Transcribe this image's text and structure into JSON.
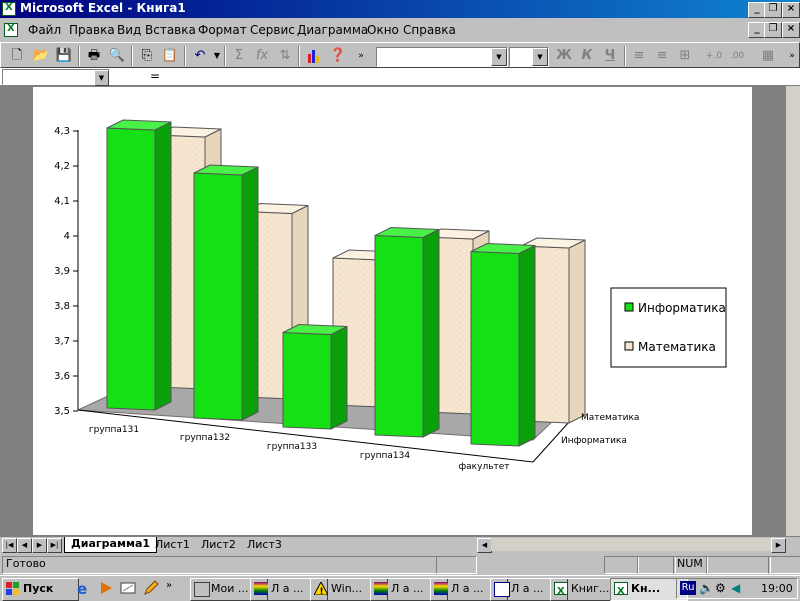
{
  "window": {
    "title": "Microsoft Excel - Книга1"
  },
  "menu": [
    "Файл",
    "Правка",
    "Вид",
    "Вставка",
    "Формат",
    "Сервис",
    "Диаграмма",
    "Окно",
    "Справка"
  ],
  "toolbar": {
    "undo_icon": "undo-icon",
    "sum_symbol": "Σ",
    "fx_symbol": "fx",
    "bold": "Ж",
    "italic": "К",
    "underline": "Ч"
  },
  "formula": {
    "eq_sign": "="
  },
  "sheet_tabs": [
    "Диаграмма1",
    "Лист1",
    "Лист2",
    "Лист3"
  ],
  "status": {
    "ready": "Готово",
    "num": "NUM"
  },
  "taskbar": {
    "start": "Пуск",
    "buttons": [
      "Мои ...",
      "Л а ...",
      "Win...",
      "Л а ...",
      "Л а ...",
      "Л а ...",
      "Книг...",
      "Кн..."
    ],
    "lang": "Ru",
    "clock": "19:00"
  },
  "chart_data": {
    "type": "bar",
    "subtype": "3d-column",
    "categories": [
      "группа131",
      "группа132",
      "группа133",
      "группа134",
      "факультет"
    ],
    "series": [
      {
        "name": "Информатика",
        "values": [
          4.3,
          4.2,
          3.77,
          4.07,
          4.05
        ],
        "color": "#14e014"
      },
      {
        "name": "Математика",
        "values": [
          4.22,
          4.03,
          3.92,
          4.0,
          4.0
        ],
        "color": "#f6e6d0"
      }
    ],
    "depth_labels": [
      "Математика",
      "Информатика"
    ],
    "yticks": [
      "3,5",
      "3,6",
      "3,7",
      "3,8",
      "3,9",
      "4",
      "4,1",
      "4,2",
      "4,3"
    ],
    "ylim": [
      3.5,
      4.3
    ],
    "legend_position": "right",
    "grid": false
  }
}
